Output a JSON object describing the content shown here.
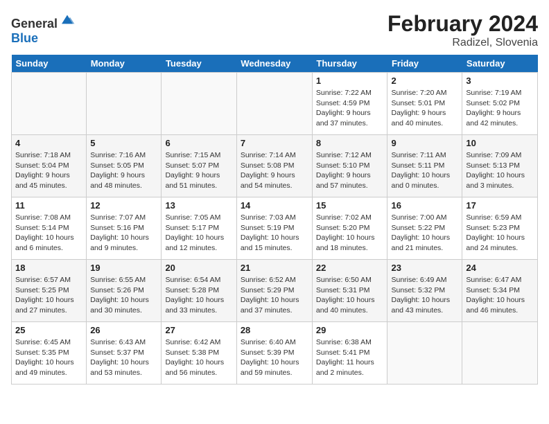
{
  "header": {
    "logo_general": "General",
    "logo_blue": "Blue",
    "month_year": "February 2024",
    "location": "Radizel, Slovenia"
  },
  "days_of_week": [
    "Sunday",
    "Monday",
    "Tuesday",
    "Wednesday",
    "Thursday",
    "Friday",
    "Saturday"
  ],
  "weeks": [
    [
      {
        "day": "",
        "info": ""
      },
      {
        "day": "",
        "info": ""
      },
      {
        "day": "",
        "info": ""
      },
      {
        "day": "",
        "info": ""
      },
      {
        "day": "1",
        "info": "Sunrise: 7:22 AM\nSunset: 4:59 PM\nDaylight: 9 hours and 37 minutes."
      },
      {
        "day": "2",
        "info": "Sunrise: 7:20 AM\nSunset: 5:01 PM\nDaylight: 9 hours and 40 minutes."
      },
      {
        "day": "3",
        "info": "Sunrise: 7:19 AM\nSunset: 5:02 PM\nDaylight: 9 hours and 42 minutes."
      }
    ],
    [
      {
        "day": "4",
        "info": "Sunrise: 7:18 AM\nSunset: 5:04 PM\nDaylight: 9 hours and 45 minutes."
      },
      {
        "day": "5",
        "info": "Sunrise: 7:16 AM\nSunset: 5:05 PM\nDaylight: 9 hours and 48 minutes."
      },
      {
        "day": "6",
        "info": "Sunrise: 7:15 AM\nSunset: 5:07 PM\nDaylight: 9 hours and 51 minutes."
      },
      {
        "day": "7",
        "info": "Sunrise: 7:14 AM\nSunset: 5:08 PM\nDaylight: 9 hours and 54 minutes."
      },
      {
        "day": "8",
        "info": "Sunrise: 7:12 AM\nSunset: 5:10 PM\nDaylight: 9 hours and 57 minutes."
      },
      {
        "day": "9",
        "info": "Sunrise: 7:11 AM\nSunset: 5:11 PM\nDaylight: 10 hours and 0 minutes."
      },
      {
        "day": "10",
        "info": "Sunrise: 7:09 AM\nSunset: 5:13 PM\nDaylight: 10 hours and 3 minutes."
      }
    ],
    [
      {
        "day": "11",
        "info": "Sunrise: 7:08 AM\nSunset: 5:14 PM\nDaylight: 10 hours and 6 minutes."
      },
      {
        "day": "12",
        "info": "Sunrise: 7:07 AM\nSunset: 5:16 PM\nDaylight: 10 hours and 9 minutes."
      },
      {
        "day": "13",
        "info": "Sunrise: 7:05 AM\nSunset: 5:17 PM\nDaylight: 10 hours and 12 minutes."
      },
      {
        "day": "14",
        "info": "Sunrise: 7:03 AM\nSunset: 5:19 PM\nDaylight: 10 hours and 15 minutes."
      },
      {
        "day": "15",
        "info": "Sunrise: 7:02 AM\nSunset: 5:20 PM\nDaylight: 10 hours and 18 minutes."
      },
      {
        "day": "16",
        "info": "Sunrise: 7:00 AM\nSunset: 5:22 PM\nDaylight: 10 hours and 21 minutes."
      },
      {
        "day": "17",
        "info": "Sunrise: 6:59 AM\nSunset: 5:23 PM\nDaylight: 10 hours and 24 minutes."
      }
    ],
    [
      {
        "day": "18",
        "info": "Sunrise: 6:57 AM\nSunset: 5:25 PM\nDaylight: 10 hours and 27 minutes."
      },
      {
        "day": "19",
        "info": "Sunrise: 6:55 AM\nSunset: 5:26 PM\nDaylight: 10 hours and 30 minutes."
      },
      {
        "day": "20",
        "info": "Sunrise: 6:54 AM\nSunset: 5:28 PM\nDaylight: 10 hours and 33 minutes."
      },
      {
        "day": "21",
        "info": "Sunrise: 6:52 AM\nSunset: 5:29 PM\nDaylight: 10 hours and 37 minutes."
      },
      {
        "day": "22",
        "info": "Sunrise: 6:50 AM\nSunset: 5:31 PM\nDaylight: 10 hours and 40 minutes."
      },
      {
        "day": "23",
        "info": "Sunrise: 6:49 AM\nSunset: 5:32 PM\nDaylight: 10 hours and 43 minutes."
      },
      {
        "day": "24",
        "info": "Sunrise: 6:47 AM\nSunset: 5:34 PM\nDaylight: 10 hours and 46 minutes."
      }
    ],
    [
      {
        "day": "25",
        "info": "Sunrise: 6:45 AM\nSunset: 5:35 PM\nDaylight: 10 hours and 49 minutes."
      },
      {
        "day": "26",
        "info": "Sunrise: 6:43 AM\nSunset: 5:37 PM\nDaylight: 10 hours and 53 minutes."
      },
      {
        "day": "27",
        "info": "Sunrise: 6:42 AM\nSunset: 5:38 PM\nDaylight: 10 hours and 56 minutes."
      },
      {
        "day": "28",
        "info": "Sunrise: 6:40 AM\nSunset: 5:39 PM\nDaylight: 10 hours and 59 minutes."
      },
      {
        "day": "29",
        "info": "Sunrise: 6:38 AM\nSunset: 5:41 PM\nDaylight: 11 hours and 2 minutes."
      },
      {
        "day": "",
        "info": ""
      },
      {
        "day": "",
        "info": ""
      }
    ]
  ]
}
